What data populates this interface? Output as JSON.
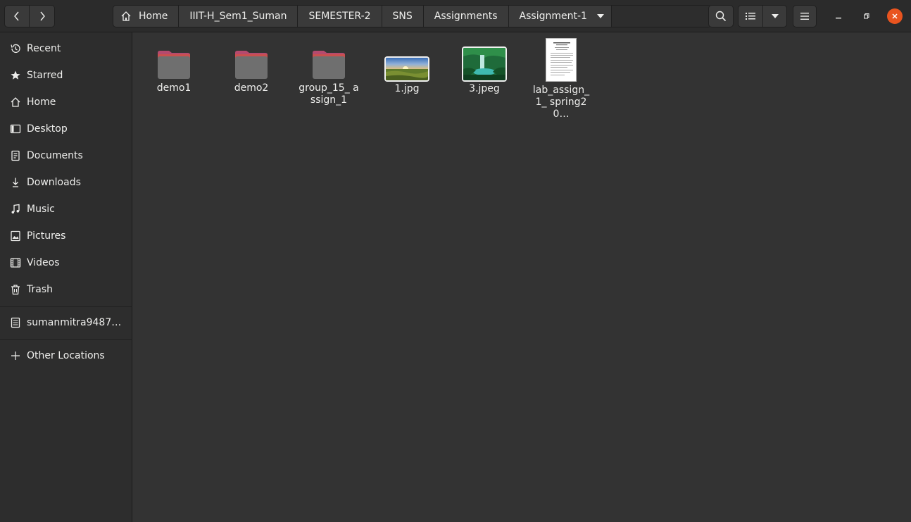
{
  "toolbar": {
    "back_icon": "chevron-left-icon",
    "forward_icon": "chevron-right-icon",
    "search_icon": "search-icon",
    "list_view_icon": "list-view-icon",
    "view_options_icon": "chevron-down-icon",
    "menu_icon": "hamburger-menu-icon"
  },
  "breadcrumb": [
    {
      "label": "Home",
      "icon": "home-icon"
    },
    {
      "label": "IIIT-H_Sem1_Suman"
    },
    {
      "label": "SEMESTER-2"
    },
    {
      "label": "SNS"
    },
    {
      "label": "Assignments"
    },
    {
      "label": "Assignment-1",
      "icon": "caret-down-icon"
    }
  ],
  "window_controls": {
    "minimize_icon": "minimize-icon",
    "maximize_icon": "maximize-icon",
    "close_icon": "close-icon",
    "close_color": "#e9541f"
  },
  "sidebar": {
    "items": [
      {
        "label": "Recent",
        "icon": "clock-icon"
      },
      {
        "label": "Starred",
        "icon": "star-icon"
      },
      {
        "label": "Home",
        "icon": "home-icon"
      },
      {
        "label": "Desktop",
        "icon": "desktop-icon"
      },
      {
        "label": "Documents",
        "icon": "document-icon"
      },
      {
        "label": "Downloads",
        "icon": "download-icon"
      },
      {
        "label": "Music",
        "icon": "music-icon"
      },
      {
        "label": "Pictures",
        "icon": "picture-icon"
      },
      {
        "label": "Videos",
        "icon": "video-icon"
      },
      {
        "label": "Trash",
        "icon": "trash-icon"
      }
    ],
    "drive": {
      "label": "sumanmitra9487…",
      "icon": "drive-icon"
    },
    "other": {
      "label": "Other Locations",
      "icon": "plus-icon"
    }
  },
  "files": [
    {
      "name": "demo1",
      "kind": "folder"
    },
    {
      "name": "demo2",
      "kind": "folder"
    },
    {
      "name": "group_15_ assign_1",
      "kind": "folder"
    },
    {
      "name": "1.jpg",
      "kind": "image"
    },
    {
      "name": "3.jpeg",
      "kind": "image"
    },
    {
      "name": "lab_assign_ 1_ spring20…",
      "kind": "document"
    }
  ],
  "colors": {
    "folder_tab": "#b54a6e",
    "folder_body": "#6f6f6f",
    "accent_close": "#e9541f"
  }
}
